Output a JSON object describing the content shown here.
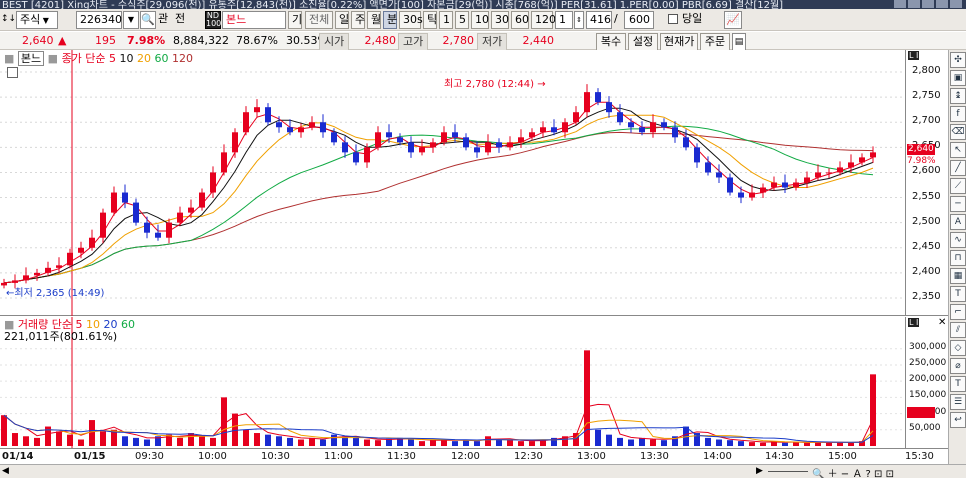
{
  "title": "BEST [4201] Xing차트 - 수식주[29,096(천)] 유통주[12,843(천)] 소진율[0.22%] 액면가[100] 자본금[29(억)] 시총[768(억)] PER[31.61] 1.PER[0.00] PBR[6.69] 결산[12월]",
  "toolbar": {
    "mode_label": "주식",
    "code_value": "226340",
    "related_label": "관",
    "chart_label": "전",
    "name_value": "본느",
    "k_label": "기",
    "all_label": "전체",
    "periods": [
      "일",
      "주",
      "월",
      "분",
      "30s",
      "틱"
    ],
    "selected_period": "분",
    "intervals": [
      "1",
      "5",
      "10",
      "30",
      "60",
      "120"
    ],
    "interval_value": "1",
    "count_value": "416",
    "count_sep": "/",
    "count_total": "600",
    "today_label": "당일"
  },
  "price_bar": {
    "price": "2,640",
    "change_arrow": "▲",
    "change": "195",
    "change_pct": "7.98%",
    "volume": "8,884,322",
    "ratio1": "78.67%",
    "ratio2": "30.53%",
    "open_label": "시가",
    "open_value": "2,480",
    "high_label": "고가",
    "high_value": "2,780",
    "low_label": "저가",
    "low_value": "2,440",
    "buttons": [
      "복수",
      "설정",
      "현재가",
      "주문"
    ]
  },
  "price_legend": {
    "name": "본느",
    "close_label": "종가 단순",
    "ma": [
      "5",
      "10",
      "20",
      "60",
      "120"
    ]
  },
  "volume_legend": {
    "name": "거래량 단순",
    "ma": [
      "5",
      "10",
      "20",
      "60"
    ],
    "value": "221,011주(801.61%)"
  },
  "annotations": {
    "high": "최고 2,780 (12:44)",
    "low": "최저 2,365 (14:49)"
  },
  "current_price_tag": "2,640",
  "current_pct_tag": "7.98%",
  "colors": {
    "up": "#e6001e",
    "down": "#1a2ad0",
    "ma5": "#e6001e",
    "ma10": "#111111",
    "ma20": "#f0a000",
    "ma60": "#11aa44",
    "ma120": "#b03030"
  },
  "chart_data": [
    {
      "type": "candlestick",
      "ylim": [
        2330,
        2820
      ],
      "y_ticks": [
        "2,800",
        "2,750",
        "2,700",
        "2,650",
        "2,600",
        "2,550",
        "2,500",
        "2,450",
        "2,400",
        "2,350"
      ],
      "x_ticks": [
        "01/14",
        "01/15",
        "09:30",
        "10:00",
        "10:30",
        "11:00",
        "11:30",
        "12:00",
        "12:30",
        "13:00",
        "13:30",
        "14:00",
        "14:30",
        "15:00",
        "15:30"
      ],
      "close_series": [
        2380,
        2385,
        2395,
        2400,
        2410,
        2415,
        2440,
        2450,
        2470,
        2520,
        2560,
        2540,
        2500,
        2480,
        2470,
        2500,
        2520,
        2530,
        2560,
        2600,
        2640,
        2680,
        2720,
        2730,
        2700,
        2690,
        2680,
        2690,
        2700,
        2680,
        2660,
        2640,
        2620,
        2650,
        2680,
        2670,
        2660,
        2640,
        2650,
        2660,
        2680,
        2670,
        2650,
        2640,
        2660,
        2650,
        2660,
        2670,
        2680,
        2690,
        2680,
        2700,
        2720,
        2760,
        2740,
        2720,
        2700,
        2690,
        2680,
        2700,
        2690,
        2670,
        2650,
        2620,
        2600,
        2590,
        2560,
        2550,
        2560,
        2570,
        2580,
        2570,
        2580,
        2590,
        2600,
        2600,
        2610,
        2620,
        2630,
        2640
      ]
    },
    {
      "type": "bar",
      "ylim": [
        0,
        330000
      ],
      "y_ticks": [
        "300,000",
        "250,000",
        "200,000",
        "150,000",
        "100,000",
        "50,000"
      ],
      "volume_series": [
        95000,
        40000,
        30000,
        25000,
        60000,
        45000,
        35000,
        20000,
        80000,
        45000,
        50000,
        30000,
        25000,
        20000,
        30000,
        35000,
        25000,
        40000,
        30000,
        25000,
        150000,
        100000,
        50000,
        40000,
        35000,
        30000,
        25000,
        20000,
        25000,
        20000,
        35000,
        30000,
        25000,
        20000,
        18000,
        22000,
        25000,
        20000,
        15000,
        18000,
        20000,
        15000,
        18000,
        15000,
        30000,
        20000,
        18000,
        15000,
        15000,
        20000,
        25000,
        30000,
        40000,
        295000,
        50000,
        35000,
        25000,
        20000,
        25000,
        20000,
        18000,
        30000,
        60000,
        40000,
        25000,
        20000,
        18000,
        15000,
        12000,
        10000,
        15000,
        10000,
        12000,
        10000,
        12000,
        10000,
        12000,
        10000,
        15000,
        221011
      ]
    }
  ]
}
